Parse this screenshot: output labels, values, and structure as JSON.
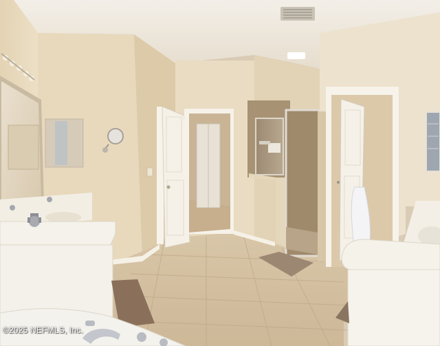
{
  "photo": {
    "watermark": "©2025 NEFMLS, Inc."
  }
}
